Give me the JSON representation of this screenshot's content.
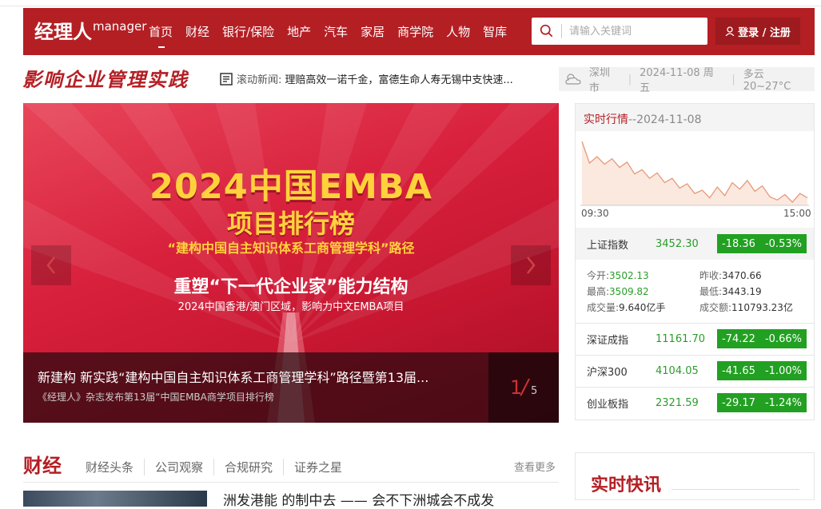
{
  "header": {
    "logo_main": "经理人",
    "logo_sup": "manager",
    "nav": [
      {
        "label": "首页",
        "active": true
      },
      {
        "label": "财经"
      },
      {
        "label": "银行/保险"
      },
      {
        "label": "地产"
      },
      {
        "label": "汽车"
      },
      {
        "label": "家居"
      },
      {
        "label": "商学院"
      },
      {
        "label": "人物"
      },
      {
        "label": "智库"
      }
    ],
    "search_placeholder": "请输入关键词",
    "login_label": "登录 / 注册"
  },
  "subheader": {
    "slogan": "影响企业管理实践",
    "ticker_label": "滚动新闻:",
    "ticker_text": "理赔高效一诺千金，富德生命人寿无锡中支快速...",
    "weather_city": "深圳市",
    "weather_date": "2024-11-08 周五",
    "weather_desc": "多云 20~27°C"
  },
  "banner": {
    "title1": "2024中国EMBA",
    "title2": "项目排行榜",
    "sub1": "“建构中国自主知识体系工商管理学科”路径",
    "sub2": "重塑“下一代企业家”能力结构",
    "sub3": "2024中国香港/澳门区域，影响力中文EMBA项目",
    "caption_title": "新建构 新实践“建构中国自主知识体系工商管理学科”路径暨第13届...",
    "caption_sub": "《经理人》杂志发布第13届“中国EMBA商学项目排行榜",
    "page_current": "1",
    "page_total": "5"
  },
  "market": {
    "head_label": "实时行情",
    "head_sep": "--",
    "head_date": "2024-11-08",
    "axis_start": "09:30",
    "axis_end": "15:00",
    "indices": [
      {
        "name": "上证指数",
        "value": "3452.30",
        "change": "-18.36",
        "pct": "-0.53%"
      },
      {
        "name": "深证成指",
        "value": "11161.70",
        "change": "-74.22",
        "pct": "-0.66%"
      },
      {
        "name": "沪深300",
        "value": "4104.05",
        "change": "-41.65",
        "pct": "-1.00%"
      },
      {
        "name": "创业板指",
        "value": "2321.59",
        "change": "-29.17",
        "pct": "-1.24%"
      }
    ],
    "detail": {
      "open_label": "今开:",
      "open": "3502.13",
      "prev_label": "昨收:",
      "prev": "3470.66",
      "high_label": "最高:",
      "high": "3509.82",
      "low_label": "最低:",
      "low": "3443.19",
      "vol_label": "成交量:",
      "vol": "9.640亿手",
      "amt_label": "成交额:",
      "amt": "110793.23亿"
    }
  },
  "section": {
    "title": "财经",
    "tabs": [
      "财经头条",
      "公司观察",
      "合规研究",
      "证券之星"
    ],
    "more": "查看更多",
    "news1": "洲发港能 的制中去 —— 会不下洲城会不成发"
  },
  "flash": {
    "title": "实时快讯"
  },
  "chart_data": {
    "type": "line",
    "x_start": "09:30",
    "x_end": "15:00",
    "values": [
      3500,
      3480,
      3486,
      3479,
      3484,
      3476,
      3481,
      3470,
      3474,
      3466,
      3471,
      3462,
      3466,
      3457,
      3461,
      3452,
      3455,
      3448,
      3458,
      3450,
      3462,
      3456,
      3464,
      3454,
      3459,
      3449,
      3446,
      3451,
      3444,
      3452,
      3448
    ],
    "colors": {
      "line": "#e59a7a",
      "fill": "#fbe9e0"
    }
  }
}
